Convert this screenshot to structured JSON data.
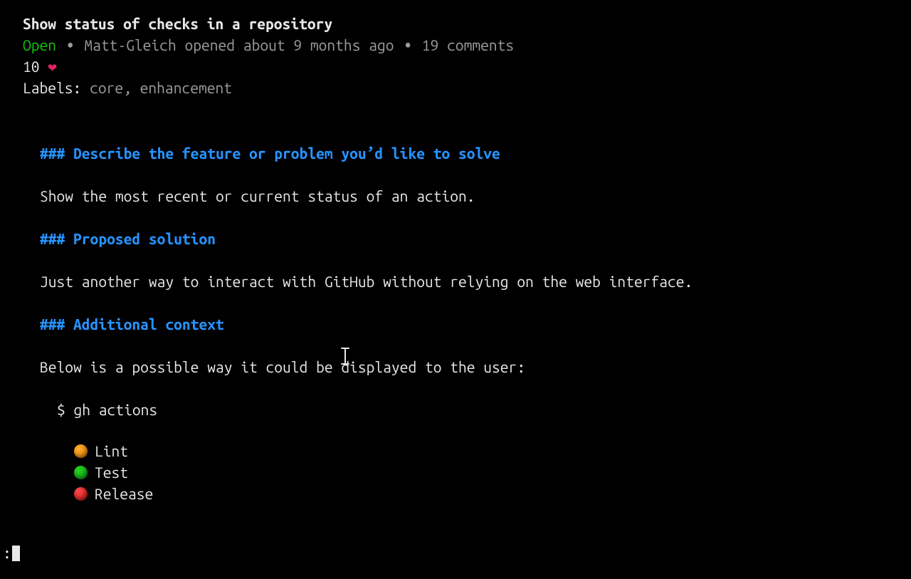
{
  "colors": {
    "status_green": "#14c514",
    "text_grey": "#9d9d9d",
    "heading_blue": "#2693ff",
    "dot_orange_a": "#ffb02e",
    "dot_orange_b": "#d87400",
    "dot_green_a": "#25d625",
    "dot_green_b": "#0b8f0b",
    "dot_red_a": "#ff4b4b",
    "dot_red_b": "#b30f0f"
  },
  "issue": {
    "title": "Show status of checks in a repository",
    "status": "Open",
    "author": "Matt-Gleich",
    "opened_relative": "about 9 months ago",
    "comments_count": "19",
    "reactions": {
      "heart_count": "10",
      "heart_glyph": "❤"
    },
    "labels_label": "Labels:",
    "labels": "core, enhancement"
  },
  "body": {
    "h1": "### Describe the feature or problem you’d like to solve",
    "p1": "Show the most recent or current status of an action.",
    "h2": "### Proposed solution",
    "p2": "Just another way to interact with GitHub without relying on the web interface.",
    "h3": "### Additional context",
    "p3": "Below is a possible way it could be displayed to the user:",
    "example_cmd": "$ gh actions",
    "actions": [
      {
        "name": "Lint",
        "color": "orange"
      },
      {
        "name": "Test",
        "color": "green"
      },
      {
        "name": "Release",
        "color": "red"
      }
    ]
  },
  "pager": {
    "prompt": ":"
  },
  "cursor": {
    "ibeam_glyph": "I"
  }
}
